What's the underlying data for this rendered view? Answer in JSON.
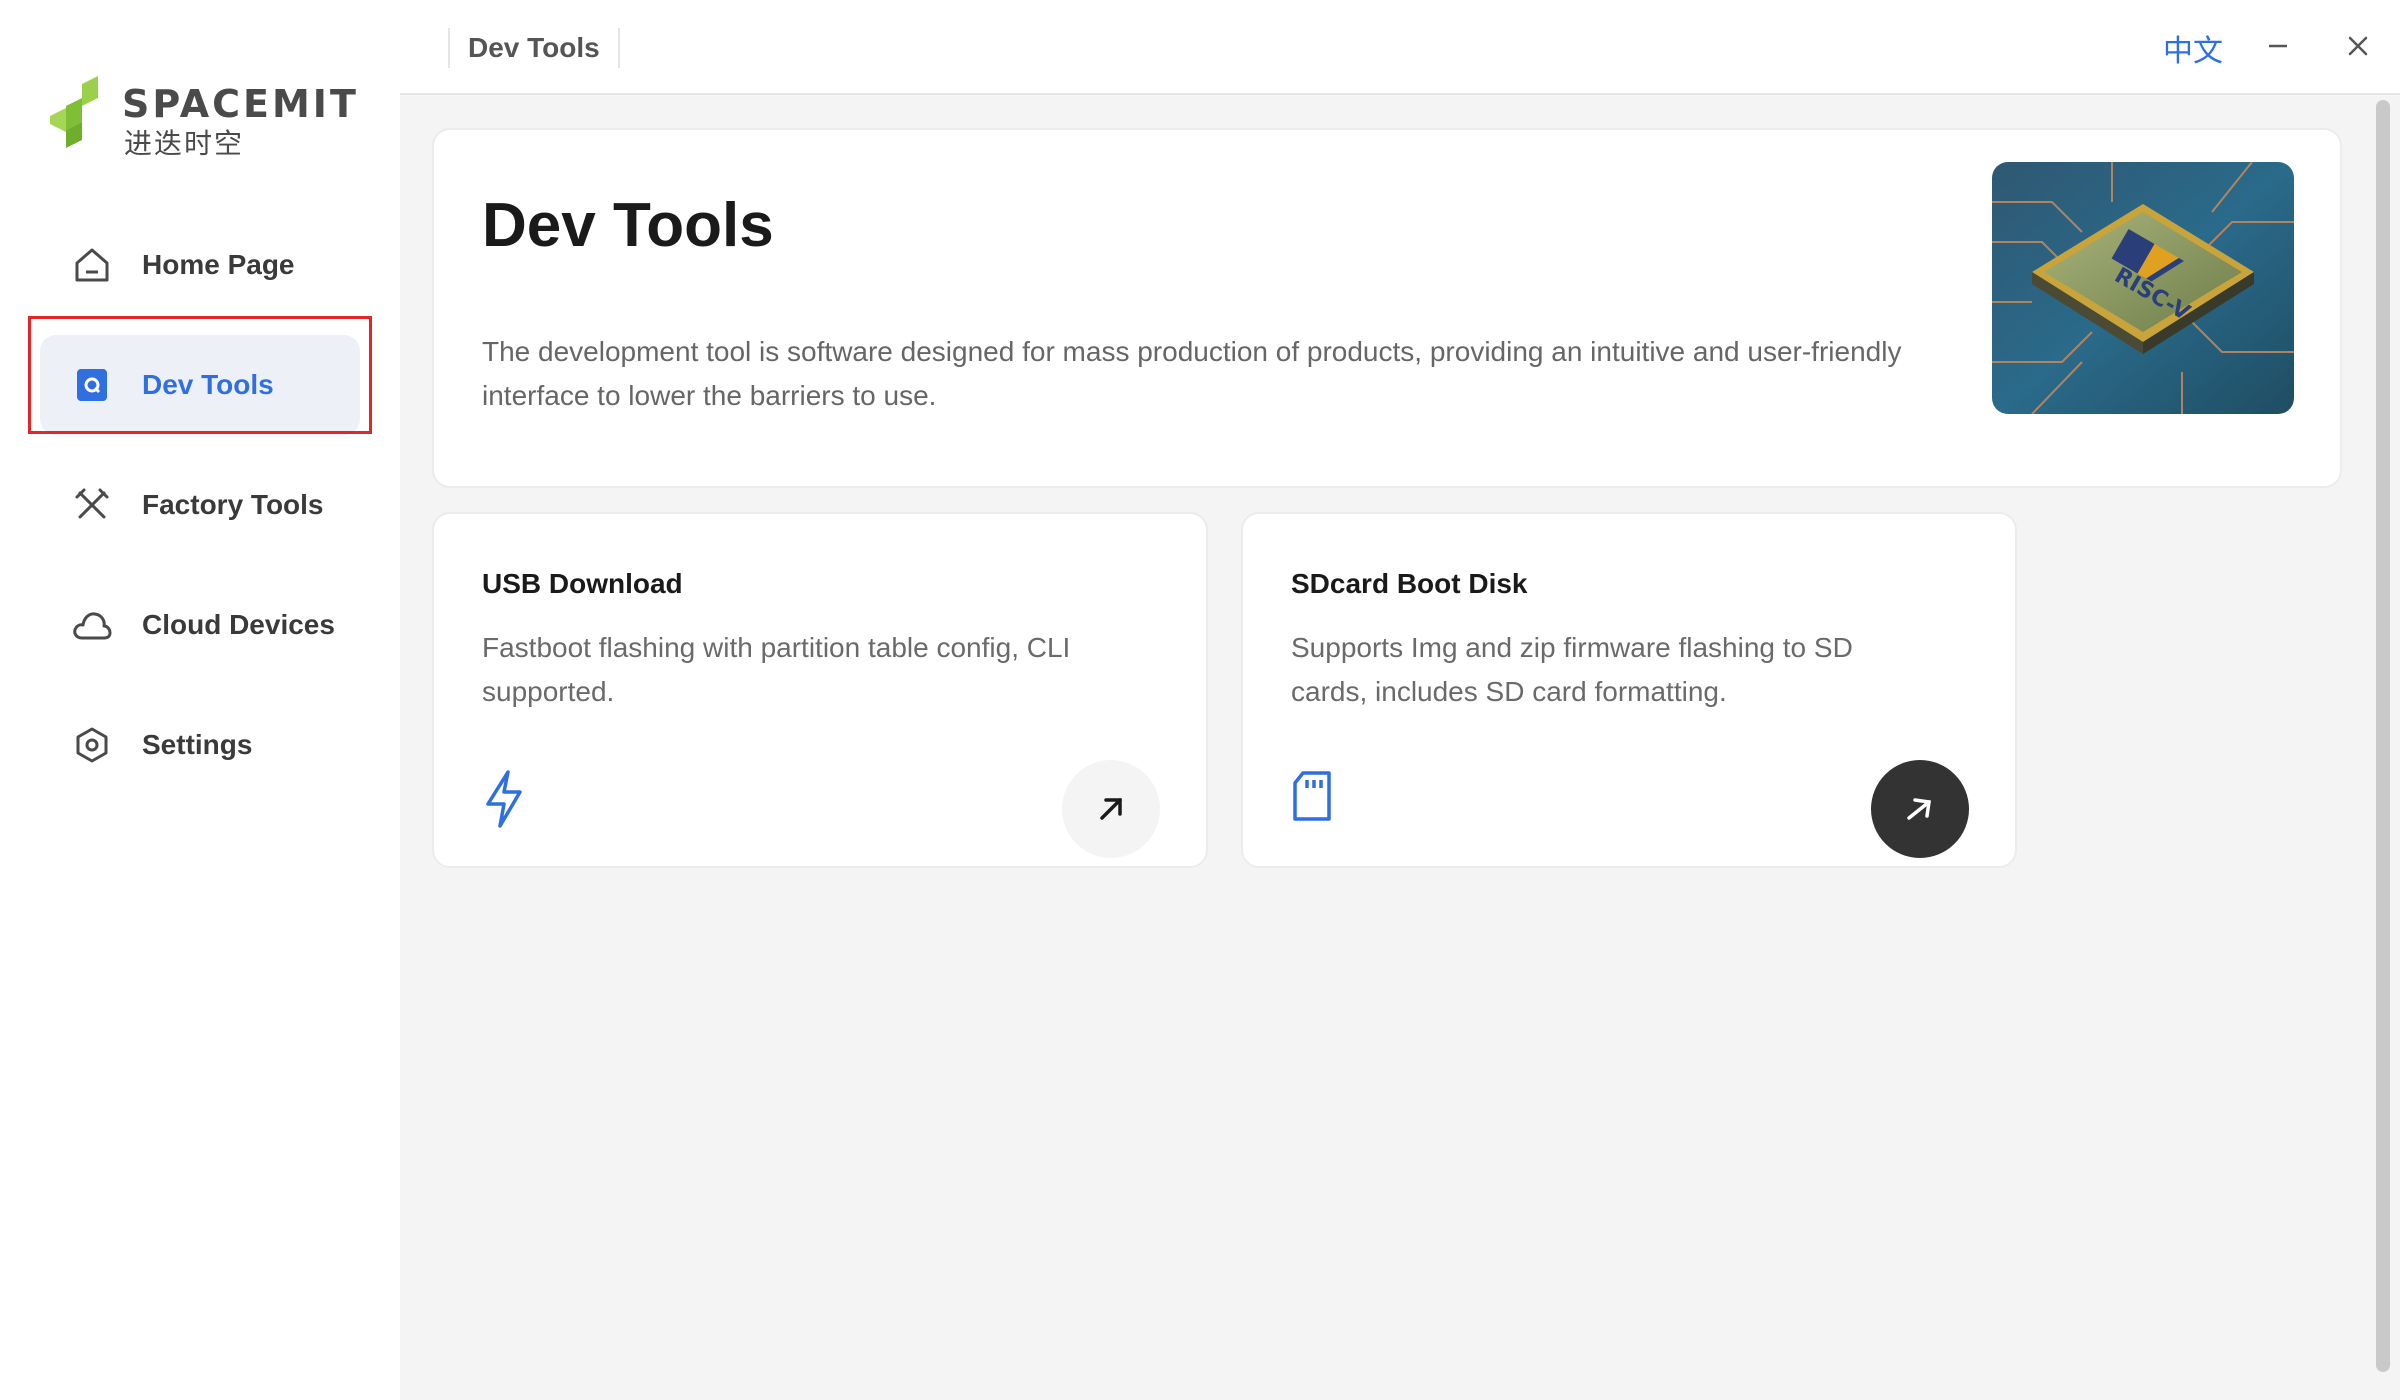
{
  "brand": {
    "name": "SPACEMIT",
    "name_cn": "进迭时空"
  },
  "sidebar": {
    "items": [
      {
        "label": "Home Page",
        "icon": "home-icon"
      },
      {
        "label": "Dev Tools",
        "icon": "dev-tools-icon",
        "active": true
      },
      {
        "label": "Factory Tools",
        "icon": "tools-icon"
      },
      {
        "label": "Cloud Devices",
        "icon": "cloud-icon"
      },
      {
        "label": "Settings",
        "icon": "settings-icon"
      }
    ]
  },
  "topbar": {
    "breadcrumb": "Dev Tools",
    "language": "中文"
  },
  "hero": {
    "title": "Dev Tools",
    "description": "The development tool is software designed for mass production of products, providing an intuitive and user-friendly interface to lower the barriers to use.",
    "image": "risc-v-chip-image"
  },
  "cards": [
    {
      "title": "USB Download",
      "description": "Fastboot flashing with partition table config, CLI supported.",
      "icon": "lightning-icon",
      "button_style": "light"
    },
    {
      "title": "SDcard Boot Disk",
      "description": "Supports Img and zip firmware flashing to SD cards, includes SD card formatting.",
      "icon": "sd-card-icon",
      "button_style": "dark"
    }
  ],
  "colors": {
    "accent": "#2f6fe0",
    "highlight_border": "#e3262a",
    "brand_green": "#8ac33e"
  }
}
